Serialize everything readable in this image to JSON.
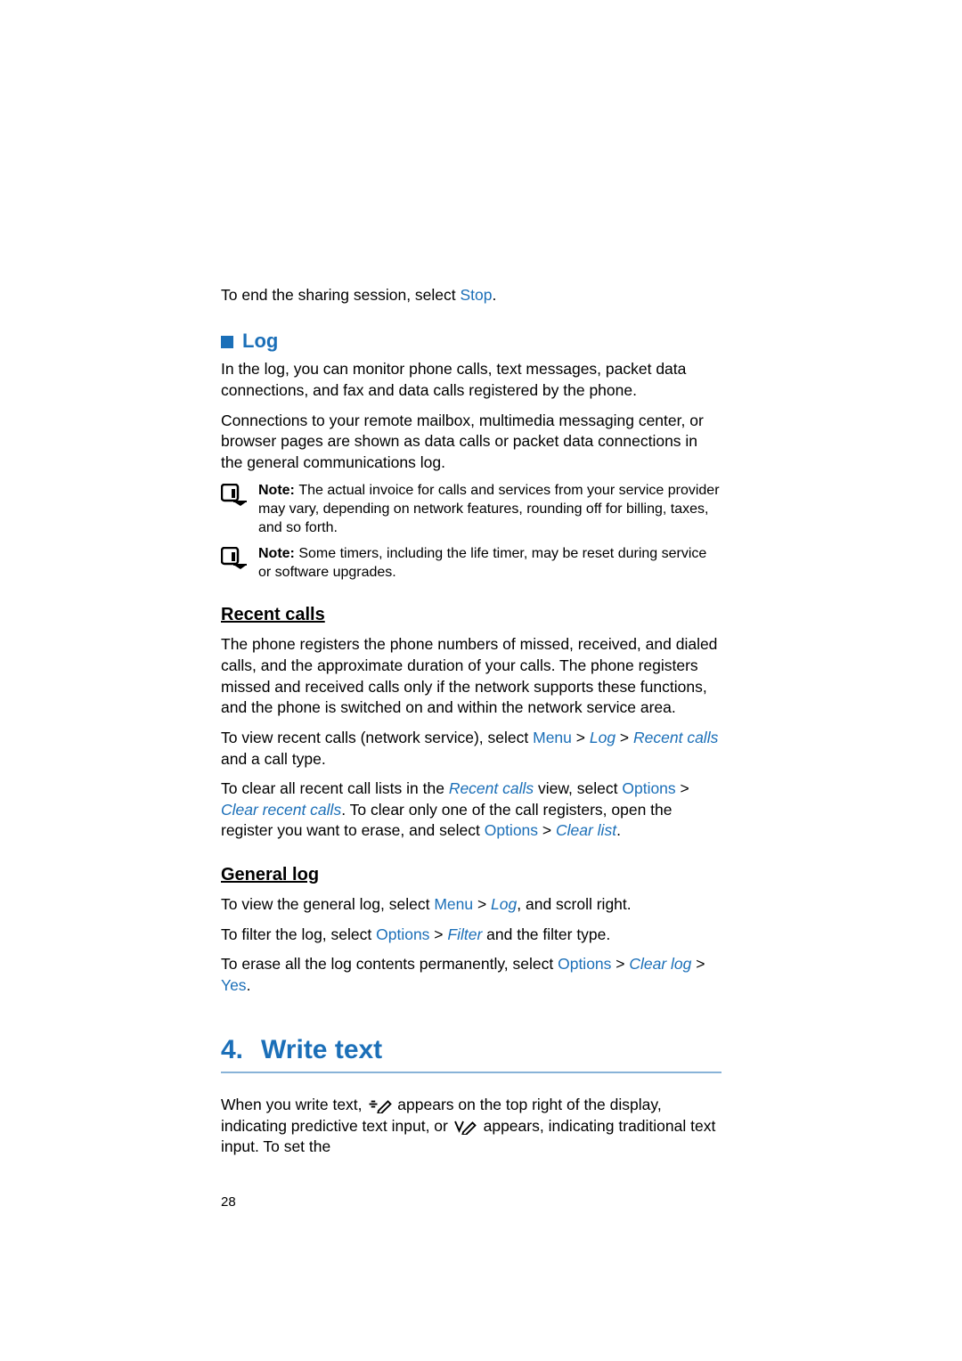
{
  "intro": {
    "end_sharing_pre": "To end the sharing session, select ",
    "stop": "Stop",
    "period": "."
  },
  "log": {
    "heading": "Log",
    "p1": "In the log, you can monitor phone calls, text messages, packet data connections, and fax and data calls registered by the phone.",
    "p2": "Connections to your remote mailbox, multimedia messaging center, or browser pages are shown as data calls or packet data connections in the general communications log.",
    "note1_label": "Note: ",
    "note1_text": "The actual invoice for calls and services from your service provider may vary, depending on network features, rounding off for billing, taxes, and so forth.",
    "note2_label": "Note: ",
    "note2_text": "Some timers, including the life timer, may be reset during service or software upgrades."
  },
  "recent": {
    "heading": "Recent calls",
    "p1": "The phone registers the phone numbers of missed, received, and dialed calls, and the approximate duration of your calls. The phone registers missed and received calls only if the network supports these functions, and the phone is switched on and within the network service area.",
    "p2_pre": "To view recent calls (network service), select ",
    "menu": "Menu",
    "gt": " > ",
    "log_link": "Log",
    "recent_calls": "Recent calls",
    "p2_post": " and a call type.",
    "p3_pre": "To clear all recent call lists in the ",
    "p3_mid": " view, select ",
    "options": "Options",
    "clear_recent_calls": "Clear recent calls",
    "p3_post1": ". To clear only one of the call registers, open the register you want to erase, and select ",
    "clear_list": "Clear list"
  },
  "general": {
    "heading": "General log",
    "p1_pre": "To view the general log, select ",
    "p1_post": ", and scroll right.",
    "p2_pre": "To filter the log, select ",
    "filter": "Filter",
    "p2_post": " and the filter type.",
    "p3_pre": "To erase all the log contents permanently, select ",
    "clear_log": "Clear log",
    "yes": "Yes"
  },
  "chapter": {
    "num": "4.",
    "title": "Write text",
    "p_pre": "When you write text, ",
    "p_mid": " appears on the top right of the display, indicating predictive text input, or ",
    "p_post": " appears, indicating traditional text input. To set the"
  },
  "page_number": "28"
}
